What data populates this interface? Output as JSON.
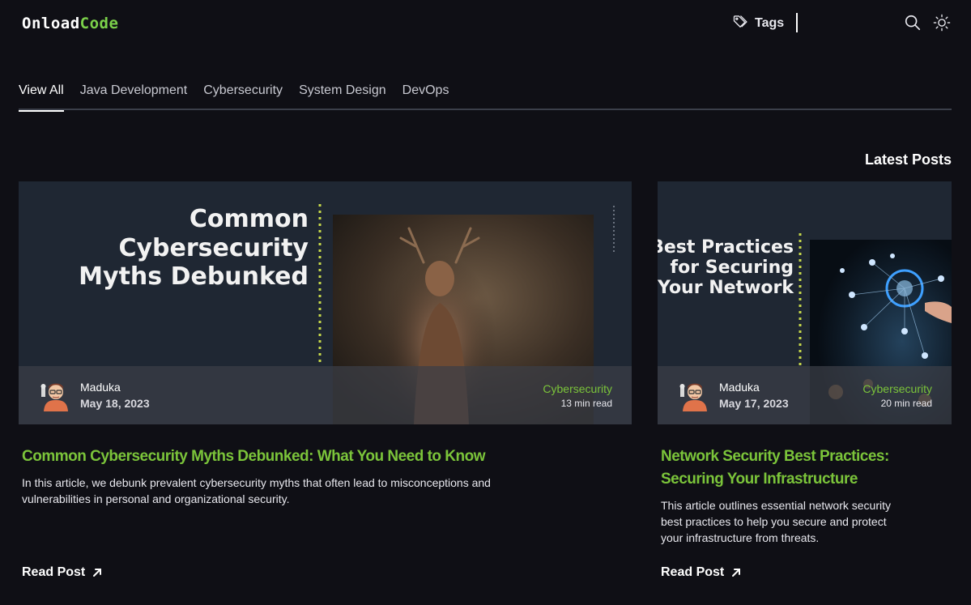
{
  "header": {
    "logo_part1": "Onload",
    "logo_part2": "Code",
    "tags_label": "Tags"
  },
  "tabs": [
    {
      "label": "View All",
      "active": true
    },
    {
      "label": "Java Development",
      "active": false
    },
    {
      "label": "Cybersecurity",
      "active": false
    },
    {
      "label": "System Design",
      "active": false
    },
    {
      "label": "DevOps",
      "active": false
    }
  ],
  "section_title": "Latest Posts",
  "posts": [
    {
      "image_text_lines": [
        "Common",
        "Cybersecurity",
        "Myths Debunked"
      ],
      "author": "Maduka",
      "date": "May 18, 2023",
      "category": "Cybersecurity",
      "read_time": "13 min read",
      "title": "Common Cybersecurity Myths Debunked: What You Need to Know",
      "description": "In this article, we debunk prevalent cybersecurity myths that often lead to misconceptions and vulnerabilities in personal and organizational security.",
      "cta": "Read Post"
    },
    {
      "image_text_lines": [
        "Best Practices",
        "for Securing",
        "Your Network"
      ],
      "author": "Maduka",
      "date": "May 17, 2023",
      "category": "Cybersecurity",
      "read_time": "20 min read",
      "title": "Network Security Best Practices: Securing Your Infrastructure",
      "description": "This article outlines essential network security best practices to help you secure and protect your infrastructure from threats.",
      "cta": "Read Post"
    }
  ],
  "colors": {
    "background": "#0f0f15",
    "accent": "#7bc43a",
    "logo_accent": "#7bd14a",
    "text": "#ffffff"
  },
  "icons": [
    "tag-icon",
    "search-icon",
    "sun-icon",
    "arrow-up-right-icon",
    "avatar"
  ]
}
